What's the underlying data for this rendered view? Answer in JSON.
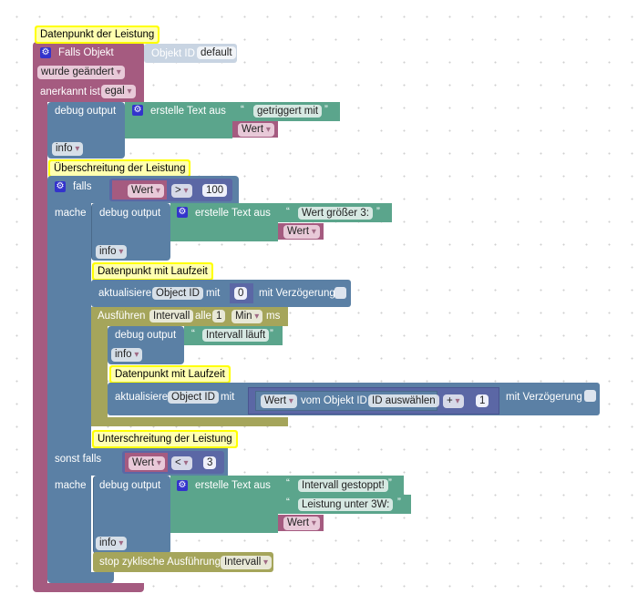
{
  "comments": {
    "c1": "Datenpunkt der Leistung",
    "c2": "Überschreitung der Leistung",
    "c3": "Datenpunkt mit Laufzeit",
    "c4": "Datenpunkt mit Laufzeit",
    "c5": "Unterschreitung der Leistung"
  },
  "event": {
    "label": "Falls Objekt",
    "object_id_label": "Objekt ID",
    "object_id_value": "default",
    "trigger": "wurde geändert",
    "ack_label": "anerkannt ist",
    "ack_value": "egal"
  },
  "debug1": {
    "label": "debug output",
    "text_label": "erstelle Text aus",
    "text1": "getriggert mit",
    "var": "Wert",
    "level": "info"
  },
  "if": {
    "falls": "falls",
    "var": "Wert",
    "op": ">",
    "num": "100",
    "mache": "mache",
    "sonst_falls": "sonst falls",
    "var2": "Wert",
    "op2": "<",
    "num2": "3",
    "mache2": "mache"
  },
  "debug2": {
    "label": "debug output",
    "text_label": "erstelle Text aus",
    "text1": "Wert größer 3:",
    "var": "Wert",
    "level": "info"
  },
  "update1": {
    "label": "aktualisiere",
    "oid": "Object ID",
    "mit": "mit",
    "num": "0",
    "delay": "mit Verzögerung"
  },
  "interval": {
    "label": "Ausführen",
    "name": "Intervall",
    "alle": "alle",
    "num": "1",
    "unit": "Min",
    "ms": "ms"
  },
  "debug3": {
    "label": "debug output",
    "text1": "Intervall läuft",
    "level": "info"
  },
  "update2": {
    "label": "aktualisiere",
    "oid": "Object ID",
    "mit": "mit",
    "var": "Wert",
    "from": "vom Objekt ID",
    "select": "ID auswählen",
    "op": "+",
    "num": "1",
    "delay": "mit Verzögerung"
  },
  "debug4": {
    "label": "debug output",
    "text_label": "erstelle Text aus",
    "text1": "Intervall gestoppt!",
    "text2": "Leistung unter 3W:",
    "var": "Wert",
    "level": "info"
  },
  "stop": {
    "label": "stop zyklische Ausführung",
    "name": "Intervall"
  }
}
